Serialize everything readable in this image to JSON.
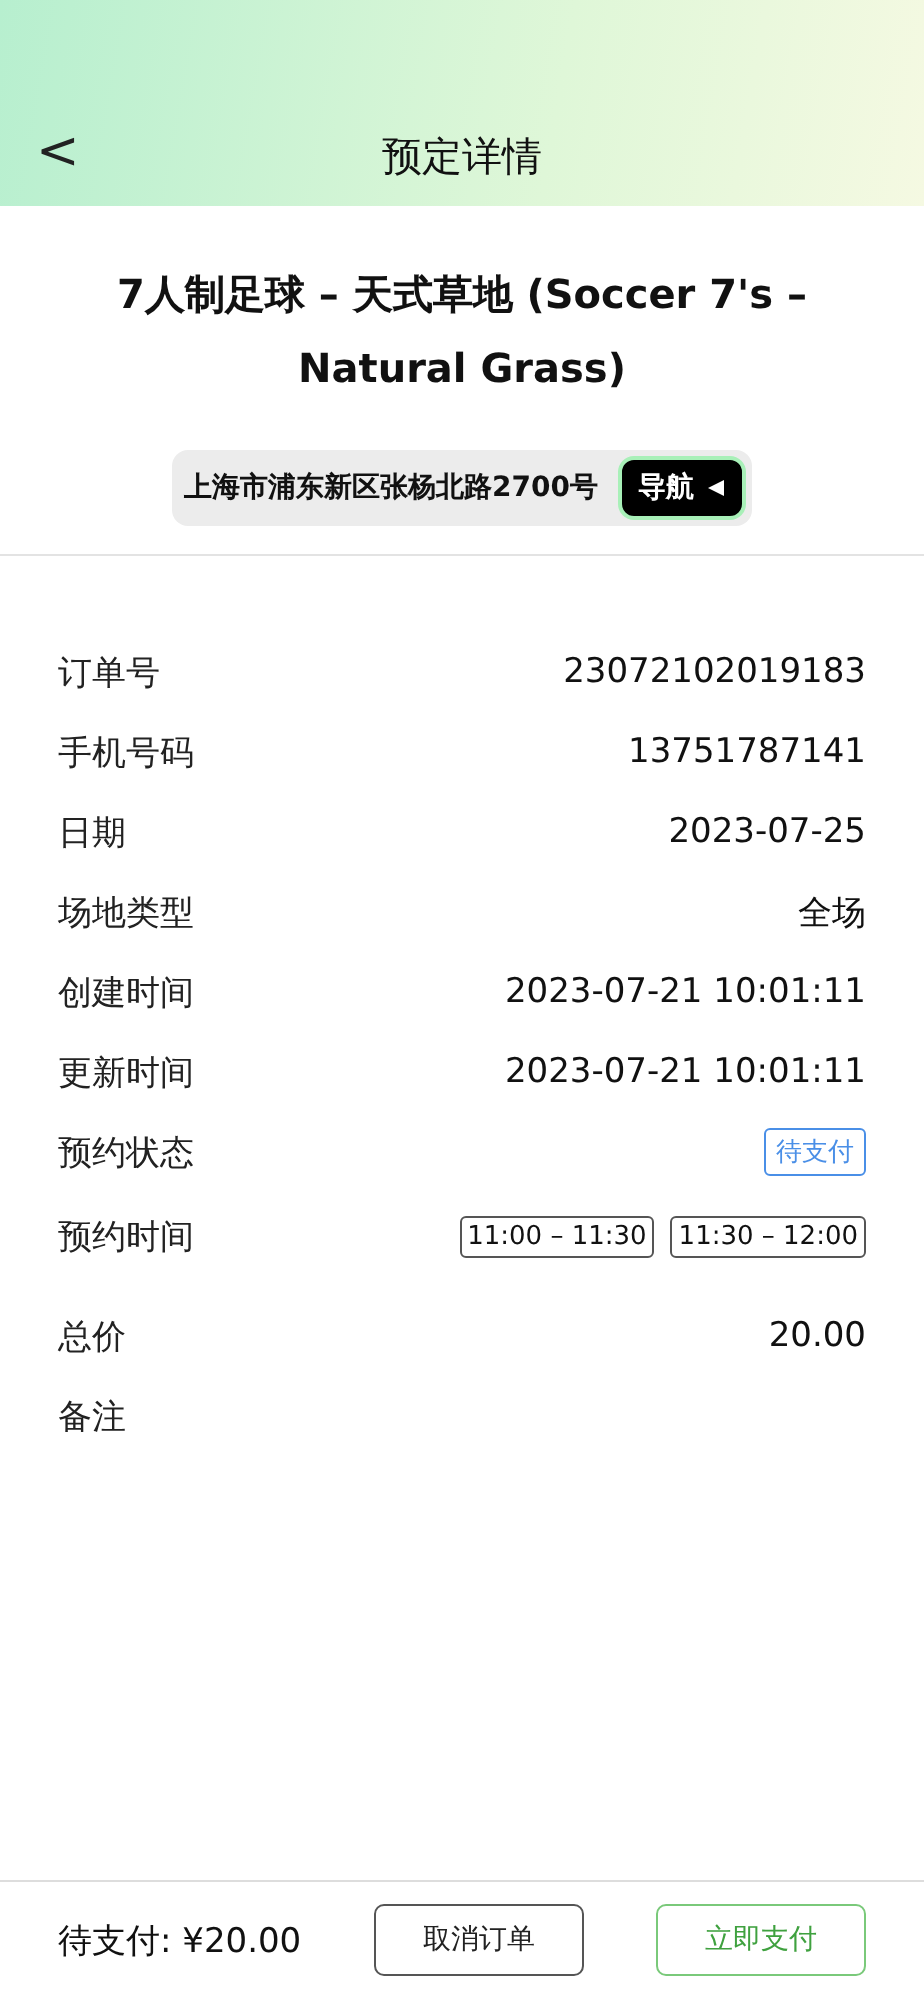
{
  "header": {
    "back": "<",
    "title": "预定详情"
  },
  "venue": {
    "name": "7人制足球 – 天式草地 (Soccer 7's – Natural Grass)",
    "address": "上海市浦东新区张杨北路2700号",
    "nav_button": "导航"
  },
  "details": [
    {
      "kind": "text",
      "label": "订单号",
      "value": "23072102019183"
    },
    {
      "kind": "text",
      "label": "手机号码",
      "value": "13751787141"
    },
    {
      "kind": "text",
      "label": "日期",
      "value": "2023-07-25"
    },
    {
      "kind": "text",
      "label": "场地类型",
      "value": "全场"
    },
    {
      "kind": "text",
      "label": "创建时间",
      "value": "2023-07-21 10:01:11"
    },
    {
      "kind": "text",
      "label": "更新时间",
      "value": "2023-07-21 10:01:11"
    },
    {
      "kind": "tag",
      "label": "预约状态",
      "value": "待支付",
      "color": "#4a8fe7"
    },
    {
      "kind": "slots",
      "label": "预约时间",
      "slots": [
        "11:00 – 11:30",
        "11:30 – 12:00"
      ]
    },
    {
      "kind": "text",
      "label": "总价",
      "value": "20.00"
    },
    {
      "kind": "text",
      "label": "备注"
    }
  ],
  "footer": {
    "due": "待支付: ¥20.00",
    "buttons": [
      {
        "kind": "secondary",
        "label": "取消订单"
      },
      {
        "kind": "primary",
        "label": "立即支付"
      }
    ]
  }
}
